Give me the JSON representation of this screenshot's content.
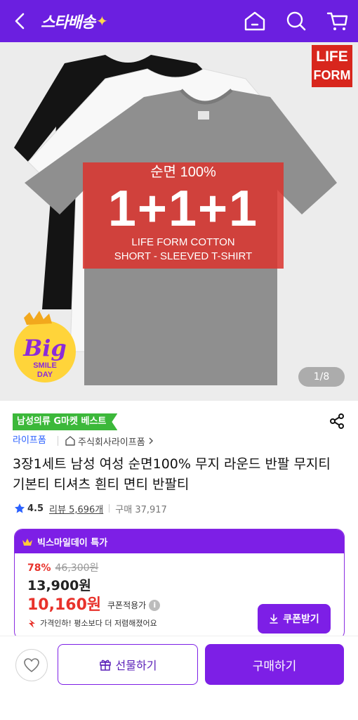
{
  "header": {
    "logo_text": "스타배송",
    "logo_spark": "✦",
    "icons": [
      "back-icon",
      "home-icon",
      "search-icon",
      "cart-icon"
    ],
    "bg_color": "#6b1fe0"
  },
  "hero": {
    "brand_logo_line1": "LIFE",
    "brand_logo_line2": "FORM",
    "promo_line1": "순면 100%",
    "promo_line2": "1+1+1",
    "promo_line3": "LIFE FORM COTTON",
    "promo_line4": "SHORT - SLEEVED T-SHIRT",
    "badge_big": "Big",
    "badge_smile": "SMILE",
    "badge_day": "DAY",
    "pager": "1/8"
  },
  "product": {
    "category_tag": "남성의류 G마켓 베스트",
    "brand": "라이프폼",
    "seller": "주식회사라이프폼",
    "title": "3장1세트 남성 여성 순면100% 무지 라운드 반팔 무지티 기본티 티셔츠 흰티 면티 반팔티",
    "rating": "4.5",
    "reviews": "리뷰 5,696개",
    "purchases": "구매 37,917"
  },
  "deal": {
    "header": "빅스마일데이 특가",
    "discount_pct": "78%",
    "original_price": "46,300원",
    "price": "13,900원",
    "coupon_price": "10,160원",
    "coupon_label": "쿠폰적용가",
    "info_icon": "i",
    "price_drop": "가격인하! 평소보다 더 저렴해졌어요",
    "coupon_button": "쿠폰받기"
  },
  "bottom_bar": {
    "gift_button": "선물하기",
    "buy_button": "구매하기"
  },
  "colors": {
    "brand_purple": "#7d1fe6",
    "sale_red": "#e8322b",
    "tag_green": "#3cb83a",
    "link_blue": "#2b61ff"
  }
}
